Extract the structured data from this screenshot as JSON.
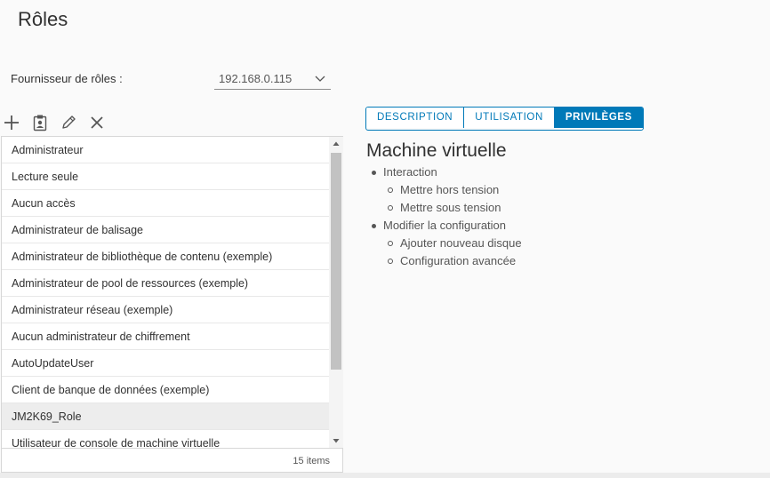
{
  "page": {
    "title": "Rôles"
  },
  "provider": {
    "label": "Fournisseur de rôles :",
    "value": "192.168.0.115"
  },
  "toolbar": {
    "add_icon": "plus-icon",
    "clone_icon": "clipboard-icon",
    "edit_icon": "pencil-icon",
    "delete_icon": "close-icon"
  },
  "roles": {
    "items": [
      "Administrateur",
      "Lecture seule",
      "Aucun accès",
      "Administrateur de balisage",
      "Administrateur de bibliothèque de contenu (exemple)",
      "Administrateur de pool de ressources (exemple)",
      "Administrateur réseau (exemple)",
      "Aucun administrateur de chiffrement",
      "AutoUpdateUser",
      "Client de banque de données (exemple)",
      "JM2K69_Role",
      "Utilisateur de console de machine virtuelle"
    ],
    "selected": "JM2K69_Role",
    "count_label": "15 items"
  },
  "tabs": [
    {
      "label": "DESCRIPTION",
      "active": false
    },
    {
      "label": "UTILISATION",
      "active": false
    },
    {
      "label": "PRIVILÈGES",
      "active": true
    }
  ],
  "detail": {
    "title": "Machine virtuelle",
    "privileges": [
      {
        "label": "Interaction",
        "children": [
          "Mettre hors tension",
          "Mettre sous tension"
        ]
      },
      {
        "label": "Modifier la configuration",
        "children": [
          "Ajouter nouveau disque",
          "Configuration avancée"
        ]
      }
    ]
  },
  "colors": {
    "accent": "#0079b8",
    "selected_row": "#ededed",
    "border": "#d7d7d7"
  }
}
